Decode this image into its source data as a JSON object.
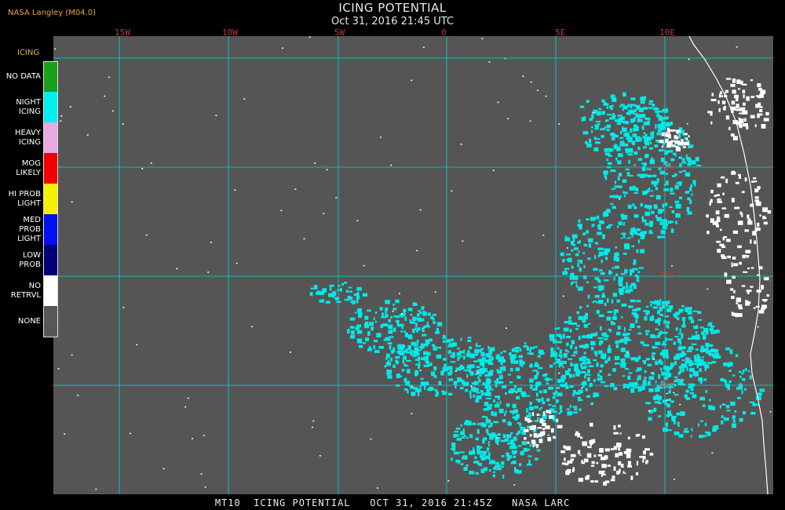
{
  "header": {
    "credit": "NASA Langley (M04.0)",
    "title": "ICING POTENTIAL",
    "subtitle": "Oct 31, 2016 21:45 UTC"
  },
  "longitude_labels": [
    "15W",
    "10W",
    "5W",
    "0",
    "5E",
    "10E"
  ],
  "latitude_labels": [
    "30S",
    "35S",
    "40S"
  ],
  "legend": {
    "title": "ICING",
    "items": [
      {
        "label_line1": "NO DATA",
        "label_line2": "",
        "color": "#1aa11a"
      },
      {
        "label_line1": "NIGHT",
        "label_line2": "ICING",
        "color": "#00f0f0"
      },
      {
        "label_line1": "HEAVY",
        "label_line2": "ICING",
        "color": "#e8a8e0"
      },
      {
        "label_line1": "MOG",
        "label_line2": "LIKELY",
        "color": "#f40000"
      },
      {
        "label_line1": "HI PROB",
        "label_line2": "LIGHT",
        "color": "#f4f000"
      },
      {
        "label_line1": "MED PROB",
        "label_line2": "LIGHT",
        "color": "#0010f0"
      },
      {
        "label_line1": "LOW",
        "label_line2": "PROB",
        "color": "#00007a"
      },
      {
        "label_line1": "NO",
        "label_line2": "RETRVL",
        "color": "#ffffff"
      },
      {
        "label_line1": "NONE",
        "label_line2": "",
        "color": "#575757"
      }
    ]
  },
  "footer": {
    "text": "MT10  ICING POTENTIAL   OCT 31, 2016 21:45Z   NASA LARC"
  },
  "colors": {
    "background": "#575757",
    "grid": "#00d8d8",
    "icing": "#00eaea",
    "no_retrieval": "#ffffff",
    "coastline": "#ffffff",
    "label": "#c0393b"
  }
}
